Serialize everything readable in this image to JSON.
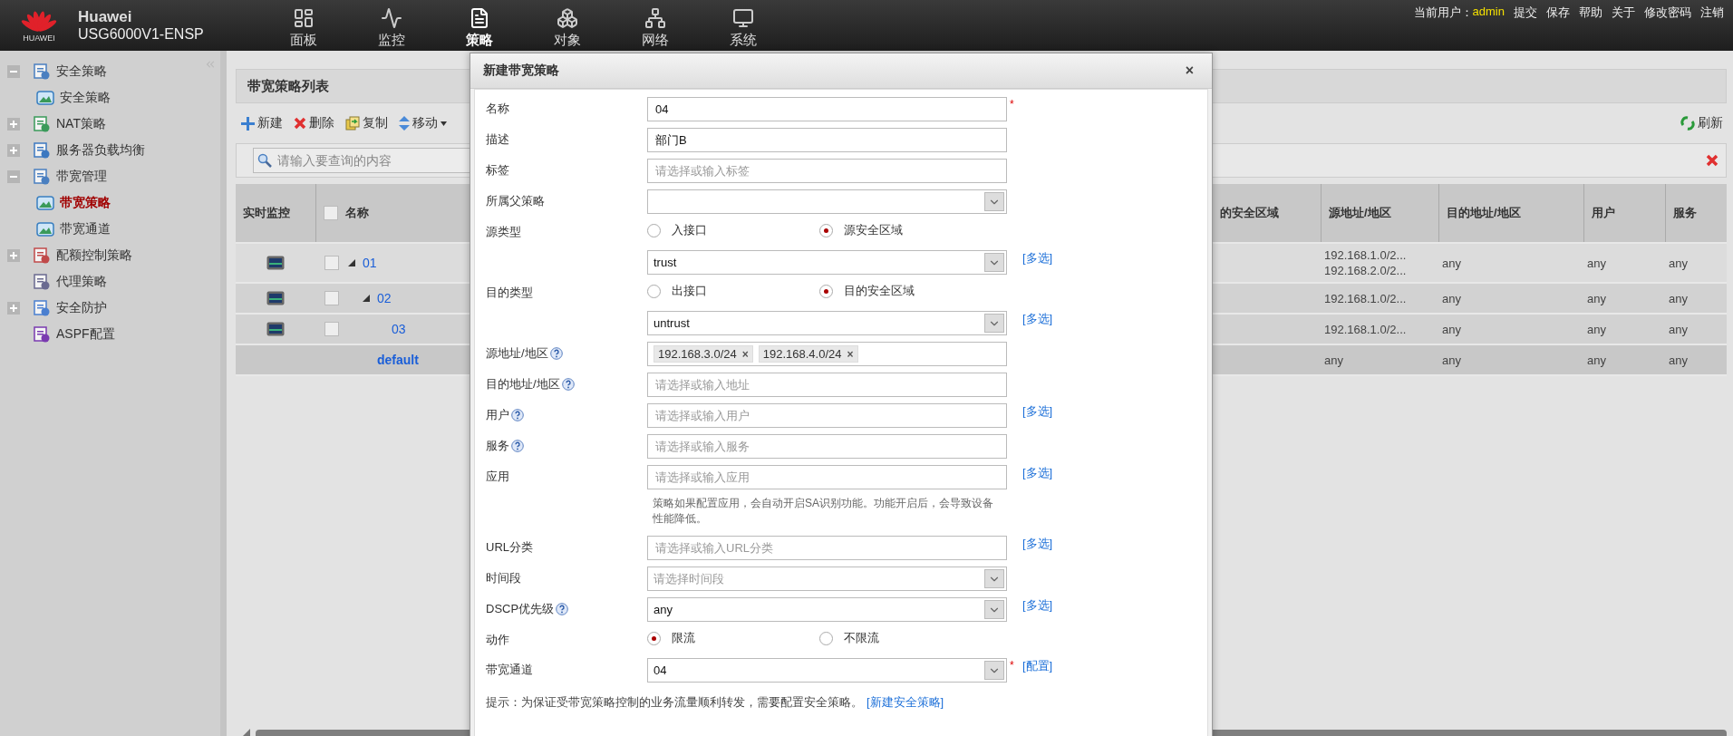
{
  "header": {
    "logo_text": "HUAWEI",
    "brand": "Huawei",
    "model": "USG6000V1-ENSP",
    "nav": [
      {
        "label": "面板",
        "selected": false
      },
      {
        "label": "监控",
        "selected": false
      },
      {
        "label": "策略",
        "selected": true
      },
      {
        "label": "对象",
        "selected": false
      },
      {
        "label": "网络",
        "selected": false
      },
      {
        "label": "系统",
        "selected": false
      }
    ],
    "user_label": "当前用户：",
    "user": "admin",
    "links": [
      "提交",
      "保存",
      "帮助",
      "关于",
      "修改密码",
      "注销"
    ]
  },
  "sidebar": {
    "items": [
      {
        "label": "安全策略",
        "kind": "folder",
        "expanded": true,
        "selected": false,
        "children": [
          {
            "label": "安全策略",
            "selected": false
          }
        ]
      },
      {
        "label": "NAT策略",
        "kind": "folder",
        "expanded": false,
        "selected": false
      },
      {
        "label": "服务器负载均衡",
        "kind": "folder",
        "expanded": false,
        "selected": false
      },
      {
        "label": "带宽管理",
        "kind": "folder",
        "expanded": true,
        "selected": false,
        "children": [
          {
            "label": "带宽策略",
            "selected": true
          },
          {
            "label": "带宽通道",
            "selected": false
          }
        ]
      },
      {
        "label": "配额控制策略",
        "kind": "folder",
        "expanded": false,
        "selected": false
      },
      {
        "label": "代理策略",
        "kind": "leaf",
        "selected": false
      },
      {
        "label": "安全防护",
        "kind": "folder",
        "expanded": false,
        "selected": false
      },
      {
        "label": "ASPF配置",
        "kind": "leaf",
        "selected": false
      }
    ]
  },
  "panel": {
    "title": "带宽策略列表",
    "select_all_checked": false,
    "toolbar": [
      {
        "label": "新建",
        "kind": "add"
      },
      {
        "label": "删除",
        "kind": "delete"
      },
      {
        "label": "复制",
        "kind": "copy"
      },
      {
        "label": "移动",
        "kind": "move"
      }
    ],
    "refresh": "刷新",
    "search": {
      "placeholder": "请输入要查询的内容"
    },
    "table": {
      "columns": [
        "实时监控",
        "名称",
        "的安全区域",
        "源地址/地区",
        "目的地址/地区",
        "用户",
        "服务"
      ],
      "rows": [
        {
          "kind": "policy",
          "name": "01",
          "expanded": true,
          "checked": false,
          "source": [
            "192.168.1.0/2...",
            "192.168.2.0/2..."
          ],
          "dest": "any",
          "user": "any",
          "service": "any",
          "children": [
            {
              "name": "02",
              "expanded": true,
              "checked": false,
              "source": [
                "192.168.1.0/2..."
              ],
              "dest": "any",
              "user": "any",
              "service": "any",
              "children": [
                {
                  "name": "03",
                  "checked": false,
                  "source": [
                    "192.168.1.0/2..."
                  ],
                  "dest": "any",
                  "user": "any",
                  "service": "any"
                }
              ]
            }
          ]
        },
        {
          "kind": "default",
          "name": "default",
          "source": [
            "any"
          ],
          "dest": "any",
          "user": "any",
          "service": "any"
        }
      ]
    }
  },
  "dialog": {
    "title": "新建带宽策略",
    "close": "×",
    "required_mark": "*",
    "remove_mark": "×",
    "fields": [
      {
        "kind": "text",
        "label": "名称",
        "value": "04",
        "required": true
      },
      {
        "kind": "text",
        "label": "描述",
        "value": "部门B"
      },
      {
        "kind": "text",
        "label": "标签",
        "placeholder": "请选择或输入标签"
      },
      {
        "kind": "select",
        "label": "所属父策略"
      },
      {
        "kind": "radio",
        "label": "源类型",
        "options": [
          {
            "label": "入接口",
            "selected": false
          },
          {
            "label": "源安全区域",
            "selected": true
          }
        ]
      },
      {
        "kind": "select",
        "value": "trust",
        "link": "[多选]"
      },
      {
        "kind": "radio",
        "label": "目的类型",
        "options": [
          {
            "label": "出接口",
            "selected": false
          },
          {
            "label": "目的安全区域",
            "selected": true
          }
        ]
      },
      {
        "kind": "select",
        "value": "untrust",
        "link": "[多选]"
      },
      {
        "kind": "tags",
        "label": "源地址/地区",
        "help": true,
        "tags": [
          "192.168.3.0/24",
          "192.168.4.0/24"
        ]
      },
      {
        "kind": "text",
        "label": "目的地址/地区",
        "help": true,
        "placeholder": "请选择或输入地址"
      },
      {
        "kind": "text",
        "label": "用户",
        "help": true,
        "placeholder": "请选择或输入用户",
        "link": "[多选]"
      },
      {
        "kind": "text",
        "label": "服务",
        "help": true,
        "placeholder": "请选择或输入服务"
      },
      {
        "kind": "text",
        "label": "应用",
        "placeholder": "请选择或输入应用",
        "link": "[多选]"
      },
      {
        "kind": "note",
        "text": "策略如果配置应用，会自动开启SA识别功能。功能开启后，会导致设备性能降低。"
      },
      {
        "kind": "text",
        "label": "URL分类",
        "placeholder": "请选择或输入URL分类",
        "link": "[多选]"
      },
      {
        "kind": "select",
        "label": "时间段",
        "placeholder": "请选择时间段"
      },
      {
        "kind": "select",
        "label": "DSCP优先级",
        "help": true,
        "value": "any",
        "link": "[多选]"
      },
      {
        "kind": "radio",
        "label": "动作",
        "options": [
          {
            "label": "限流",
            "selected": true
          },
          {
            "label": "不限流",
            "selected": false
          }
        ]
      },
      {
        "kind": "select",
        "label": "带宽通道",
        "value": "04",
        "required": true,
        "link": "[配置]"
      }
    ],
    "hint": {
      "text": "提示：为保证受带宽策略控制的业务流量顺利转发，需要配置安全策略。",
      "link": "[新建安全策略]"
    }
  }
}
